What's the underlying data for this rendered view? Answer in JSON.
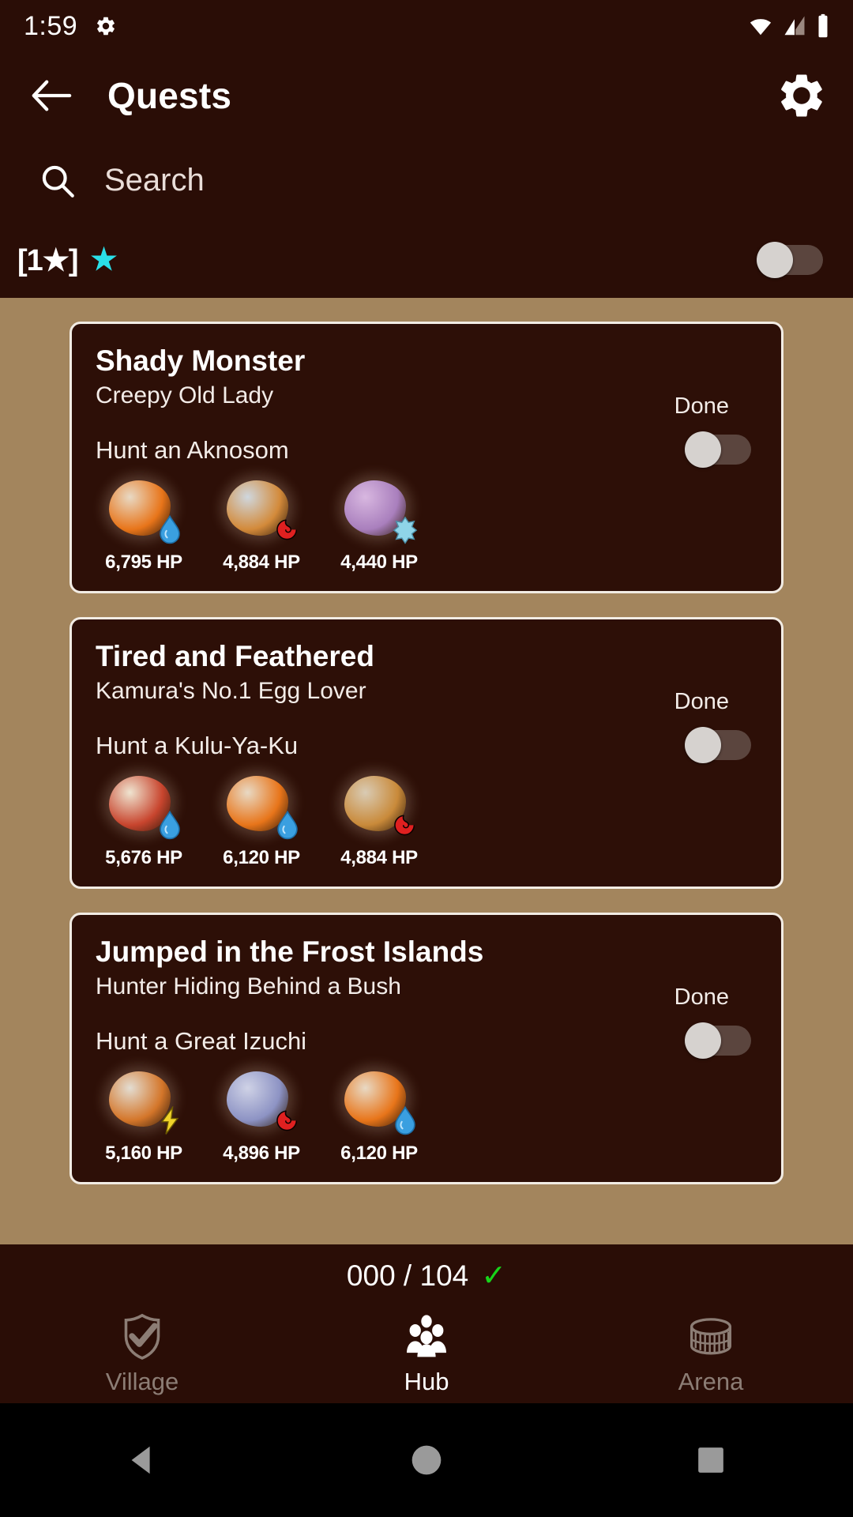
{
  "status_bar": {
    "time": "1:59",
    "icons": [
      "settings-gear",
      "wifi",
      "cellular",
      "battery"
    ]
  },
  "app_bar": {
    "back_icon": "arrow-back-icon",
    "title": "Quests",
    "settings_icon": "gear-icon"
  },
  "search": {
    "icon": "search-icon",
    "placeholder": "Search",
    "value": ""
  },
  "filter": {
    "label": "[1★]",
    "star_glyph": "★",
    "star_color": "#2ae0e8",
    "toggle_state": "off"
  },
  "colors": {
    "app_background": "#2a0d06",
    "list_background": "#a3855d",
    "card_background": "#2d0f07",
    "card_border": "#f2ece4",
    "accent_star": "#2ae0e8",
    "check_green": "#17d41a",
    "toggle_thumb": "#d6d2cf",
    "toggle_track": "#5b453e"
  },
  "quests": [
    {
      "title": "Shady Monster",
      "client": "Creepy Old Lady",
      "objective": "Hunt an Aknosom",
      "done_label": "Done",
      "toggle_state": "off",
      "monsters": [
        {
          "name": "aknosom",
          "hp": "6,795 HP",
          "element": "water",
          "element_color": "#3a9fe0",
          "body": "#e8d9c4",
          "accent": "#e8751a"
        },
        {
          "name": "kulu-ya-ku",
          "hp": "4,884 HP",
          "element": "fire",
          "element_color": "#e02020",
          "body": "#cfd7de",
          "accent": "#d38a3a"
        },
        {
          "name": "khezu",
          "hp": "4,440 HP",
          "element": "ice",
          "element_color": "#8fd4e8",
          "body": "#d8b7e0",
          "accent": "#a97fbd"
        }
      ]
    },
    {
      "title": "Tired and Feathered",
      "client": "Kamura's No.1 Egg Lover",
      "objective": "Hunt a Kulu-Ya-Ku",
      "done_label": "Done",
      "toggle_state": "off",
      "monsters": [
        {
          "name": "great-baggi",
          "hp": "5,676 HP",
          "element": "water",
          "element_color": "#3a9fe0",
          "body": "#efe4d0",
          "accent": "#c8452e"
        },
        {
          "name": "aknosom",
          "hp": "6,120 HP",
          "element": "water",
          "element_color": "#3a9fe0",
          "body": "#e8d9c4",
          "accent": "#e8751a"
        },
        {
          "name": "kulu-ya-ku",
          "hp": "4,884 HP",
          "element": "fire",
          "element_color": "#e02020",
          "body": "#d9cbb4",
          "accent": "#c98a3a"
        }
      ]
    },
    {
      "title": "Jumped in the Frost Islands",
      "client": "Hunter Hiding Behind a Bush",
      "objective": "Hunt a Great Izuchi",
      "done_label": "Done",
      "toggle_state": "off",
      "monsters": [
        {
          "name": "great-izuchi",
          "hp": "5,160 HP",
          "element": "thunder",
          "element_color": "#f0d32a",
          "body": "#e3ddd2",
          "accent": "#d4762a"
        },
        {
          "name": "lagombi",
          "hp": "4,896 HP",
          "element": "fire",
          "element_color": "#e02020",
          "body": "#cfd2e6",
          "accent": "#8d93c4"
        },
        {
          "name": "aknosom",
          "hp": "6,120 HP",
          "element": "water",
          "element_color": "#3a9fe0",
          "body": "#e8d9c4",
          "accent": "#e8751a"
        }
      ]
    }
  ],
  "bottom": {
    "counter": "000 / 104",
    "counter_check": "✓",
    "nav": [
      {
        "label": "Village",
        "icon": "shield-check-icon",
        "active": false
      },
      {
        "label": "Hub",
        "icon": "people-group-icon",
        "active": true
      },
      {
        "label": "Arena",
        "icon": "colosseum-icon",
        "active": false
      }
    ]
  },
  "android_nav": {
    "back": "triangle-back-icon",
    "home": "circle-home-icon",
    "recents": "square-recents-icon"
  }
}
